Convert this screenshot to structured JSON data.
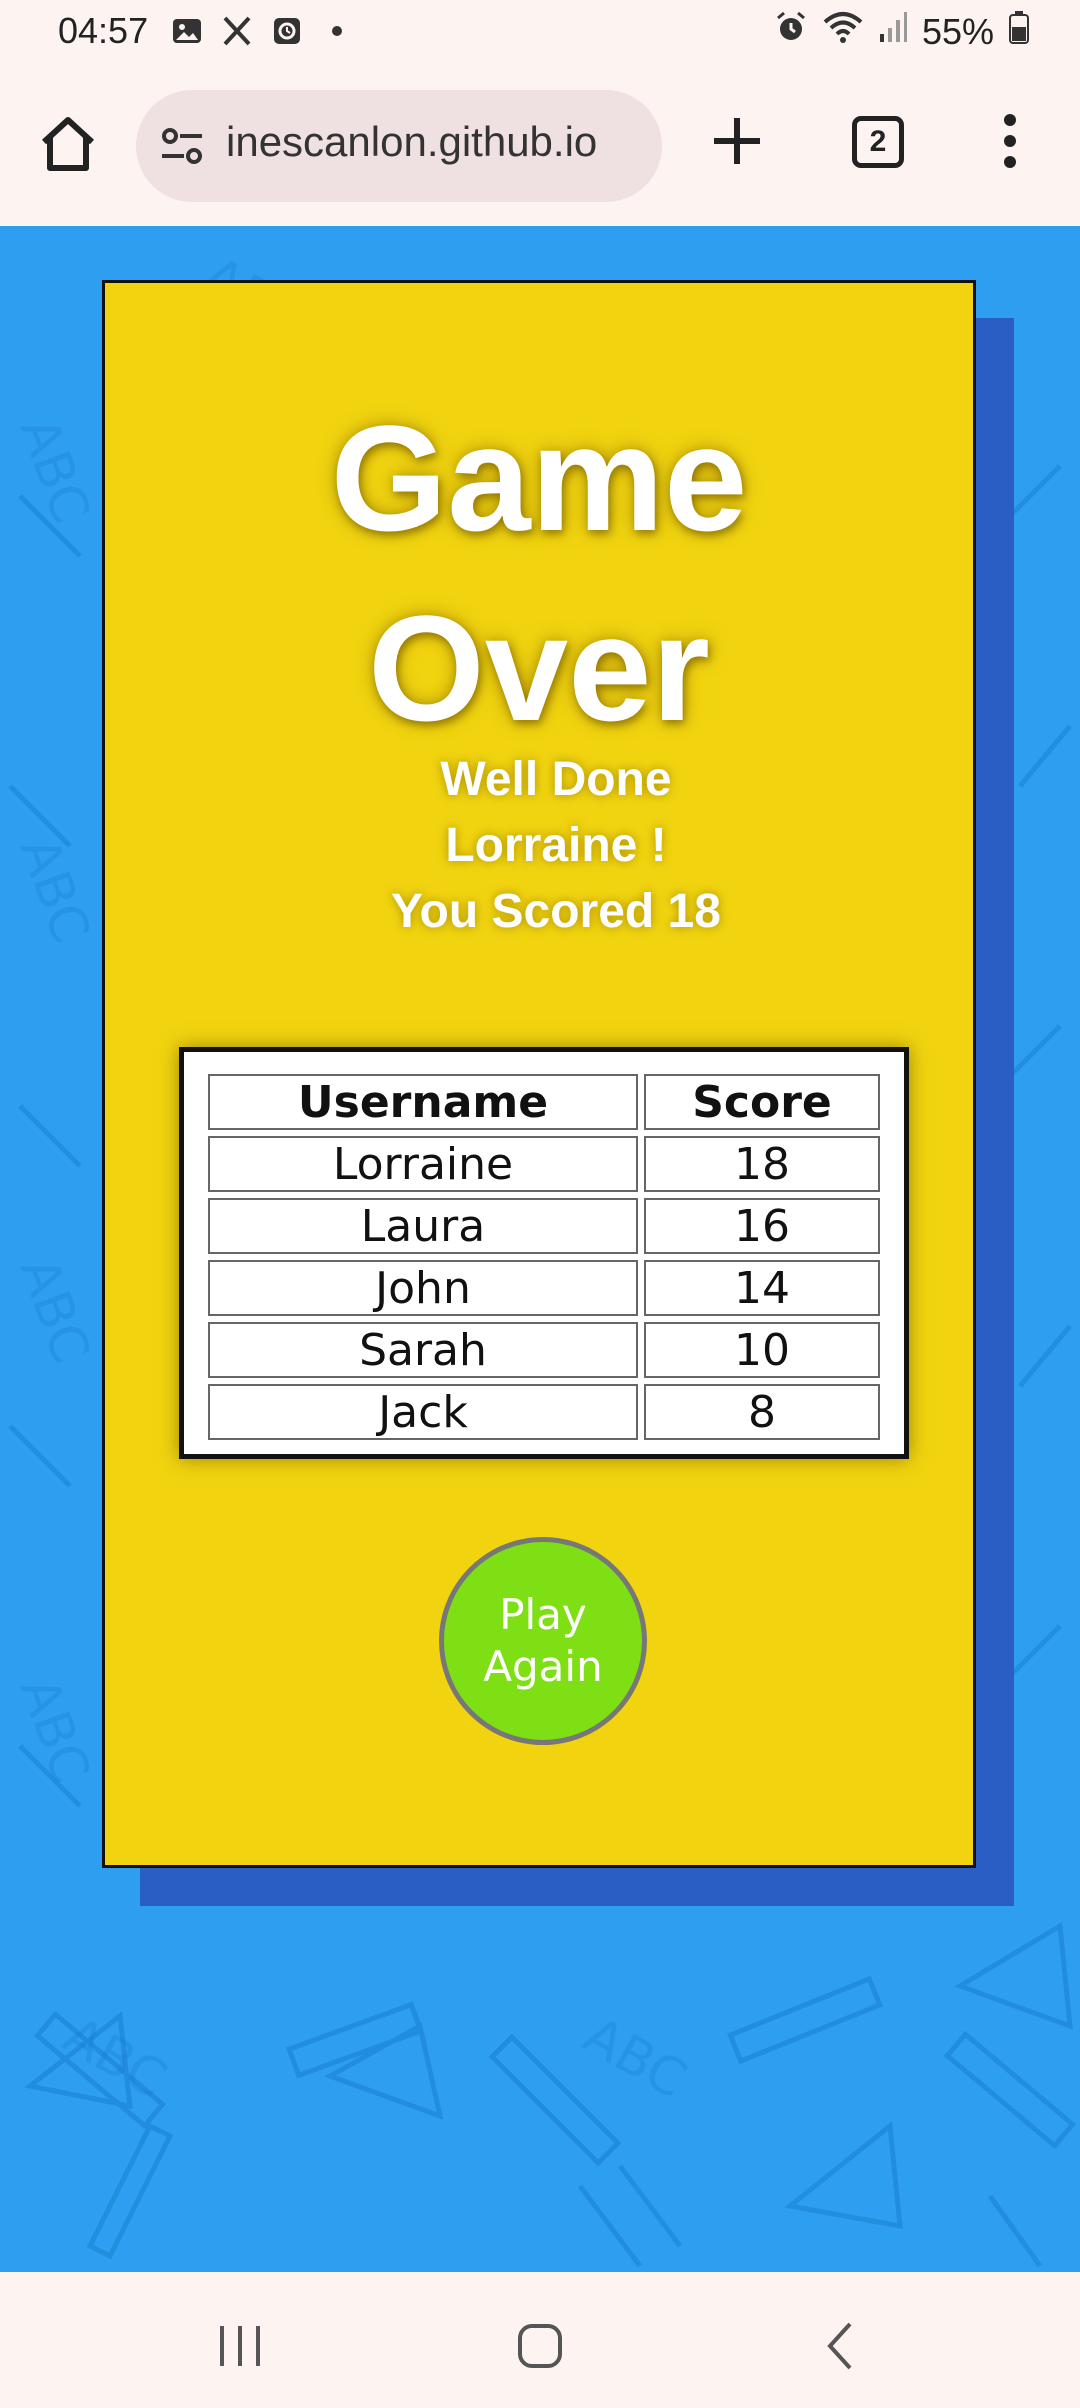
{
  "status_bar": {
    "time": "04:57",
    "battery": "55%",
    "left_icons": [
      "image-icon",
      "x-icon",
      "clock-app-icon",
      "dot-icon"
    ],
    "right_icons": [
      "alarm-icon",
      "wifi-icon",
      "signal-icon",
      "battery-icon"
    ]
  },
  "browser": {
    "url": "inescanlon.github.io",
    "tab_count": "2"
  },
  "game": {
    "title_line1": "Game",
    "title_line2": "Over",
    "message_line1": "Well Done",
    "message_line2": "Lorraine !",
    "message_line3": "You Scored 18",
    "table": {
      "headers": [
        "Username",
        "Score"
      ],
      "rows": [
        [
          "Lorraine",
          "18"
        ],
        [
          "Laura",
          "16"
        ],
        [
          "John",
          "14"
        ],
        [
          "Sarah",
          "10"
        ],
        [
          "Jack",
          "8"
        ]
      ]
    },
    "play_again_line1": "Play",
    "play_again_line2": "Again"
  },
  "colors": {
    "page_background": "#2e9ff0",
    "card": "#f1d40f",
    "card_shadow": "#2a5ec4",
    "play_button": "#7ee014"
  }
}
